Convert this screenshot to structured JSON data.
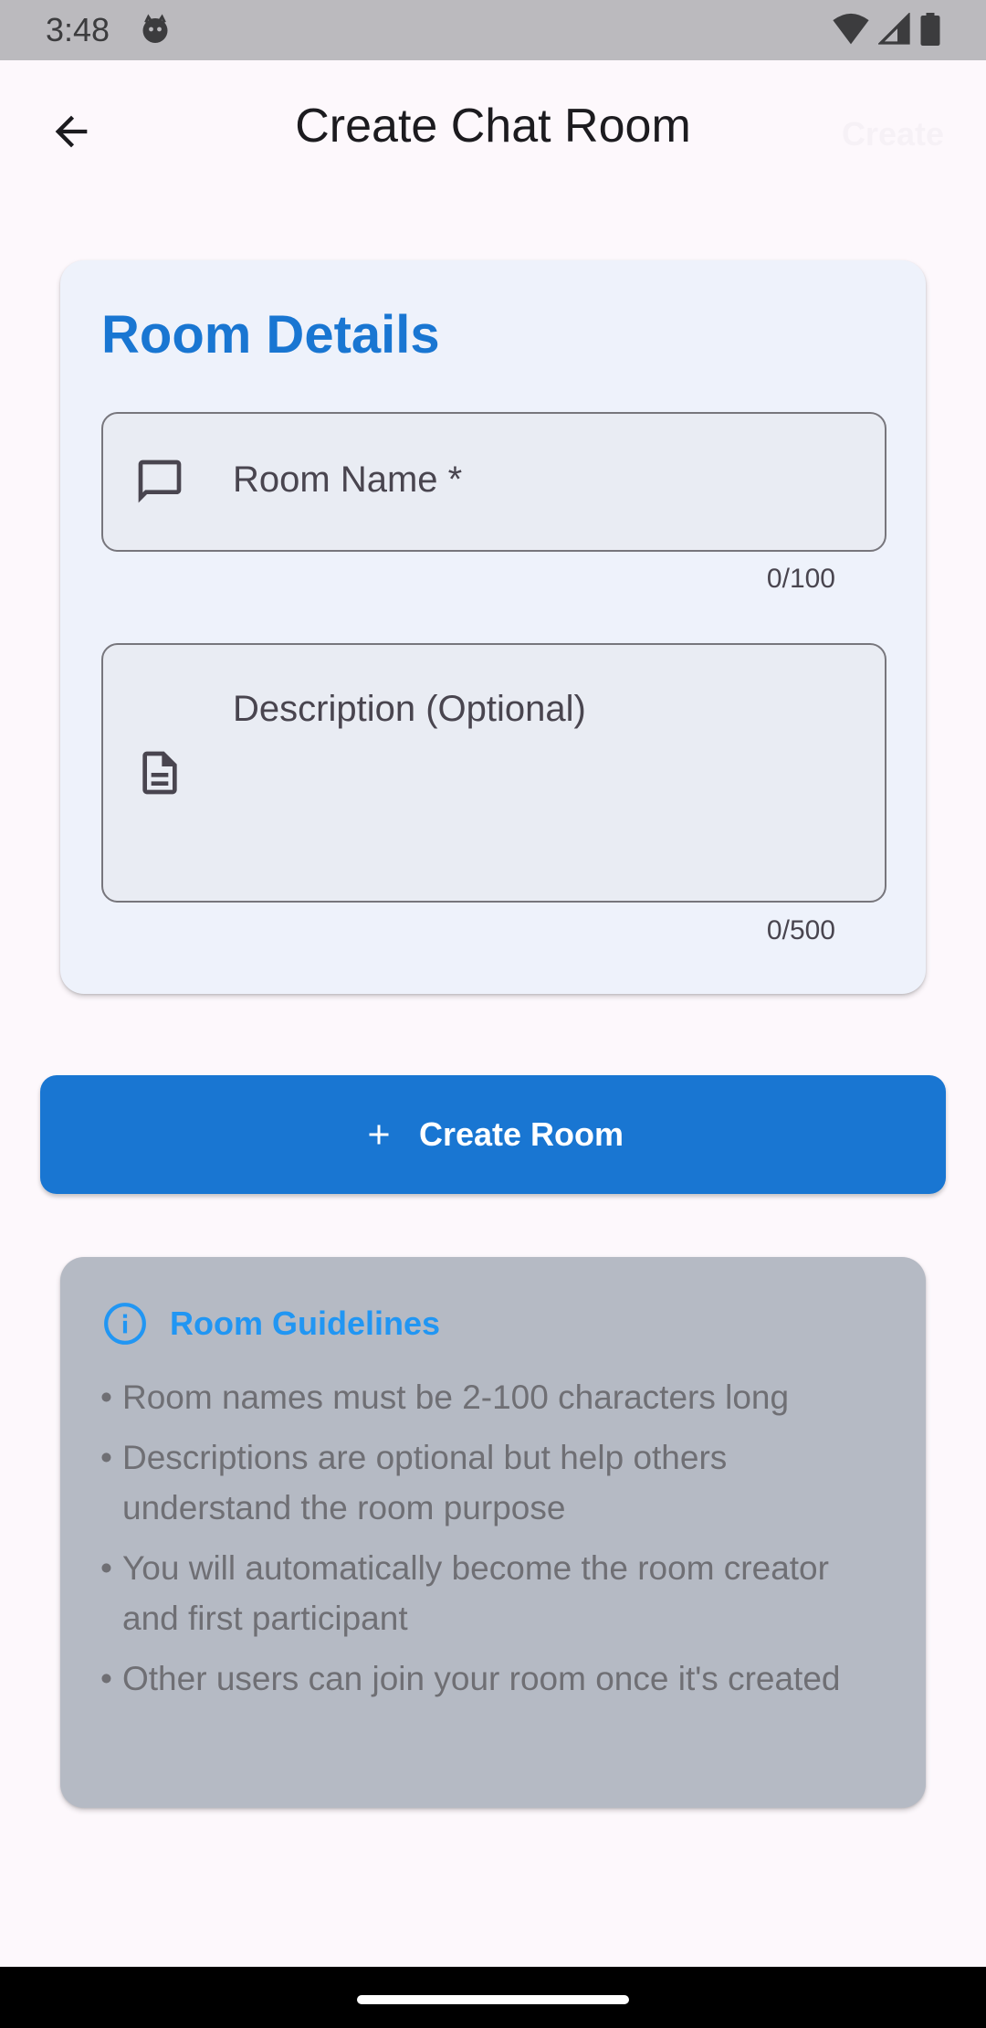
{
  "status_bar": {
    "time": "3:48"
  },
  "app_bar": {
    "title": "Create Chat Room",
    "action_label": "Create"
  },
  "room_details": {
    "title": "Room Details",
    "name_field": {
      "label": "Room Name *",
      "counter": "0/100"
    },
    "description_field": {
      "label": "Description (Optional)",
      "counter": "0/500"
    }
  },
  "create_button": {
    "label": "Create Room"
  },
  "guidelines": {
    "title": "Room Guidelines",
    "items": [
      "Room names must be 2-100 characters long",
      "Descriptions are optional but help others understand the room purpose",
      "You will automatically become the room creator and first participant",
      "Other users can join your room once it's created"
    ]
  },
  "colors": {
    "accent": "#1976d2",
    "guideline_title": "#2196f3",
    "card_background": "#eef2fb",
    "guideline_card": "#b5bac4"
  },
  "icons": {
    "back": "arrow-left-icon",
    "name_field": "chat-bubble-icon",
    "description_field": "document-icon",
    "create": "plus-icon",
    "guidelines": "info-icon"
  }
}
